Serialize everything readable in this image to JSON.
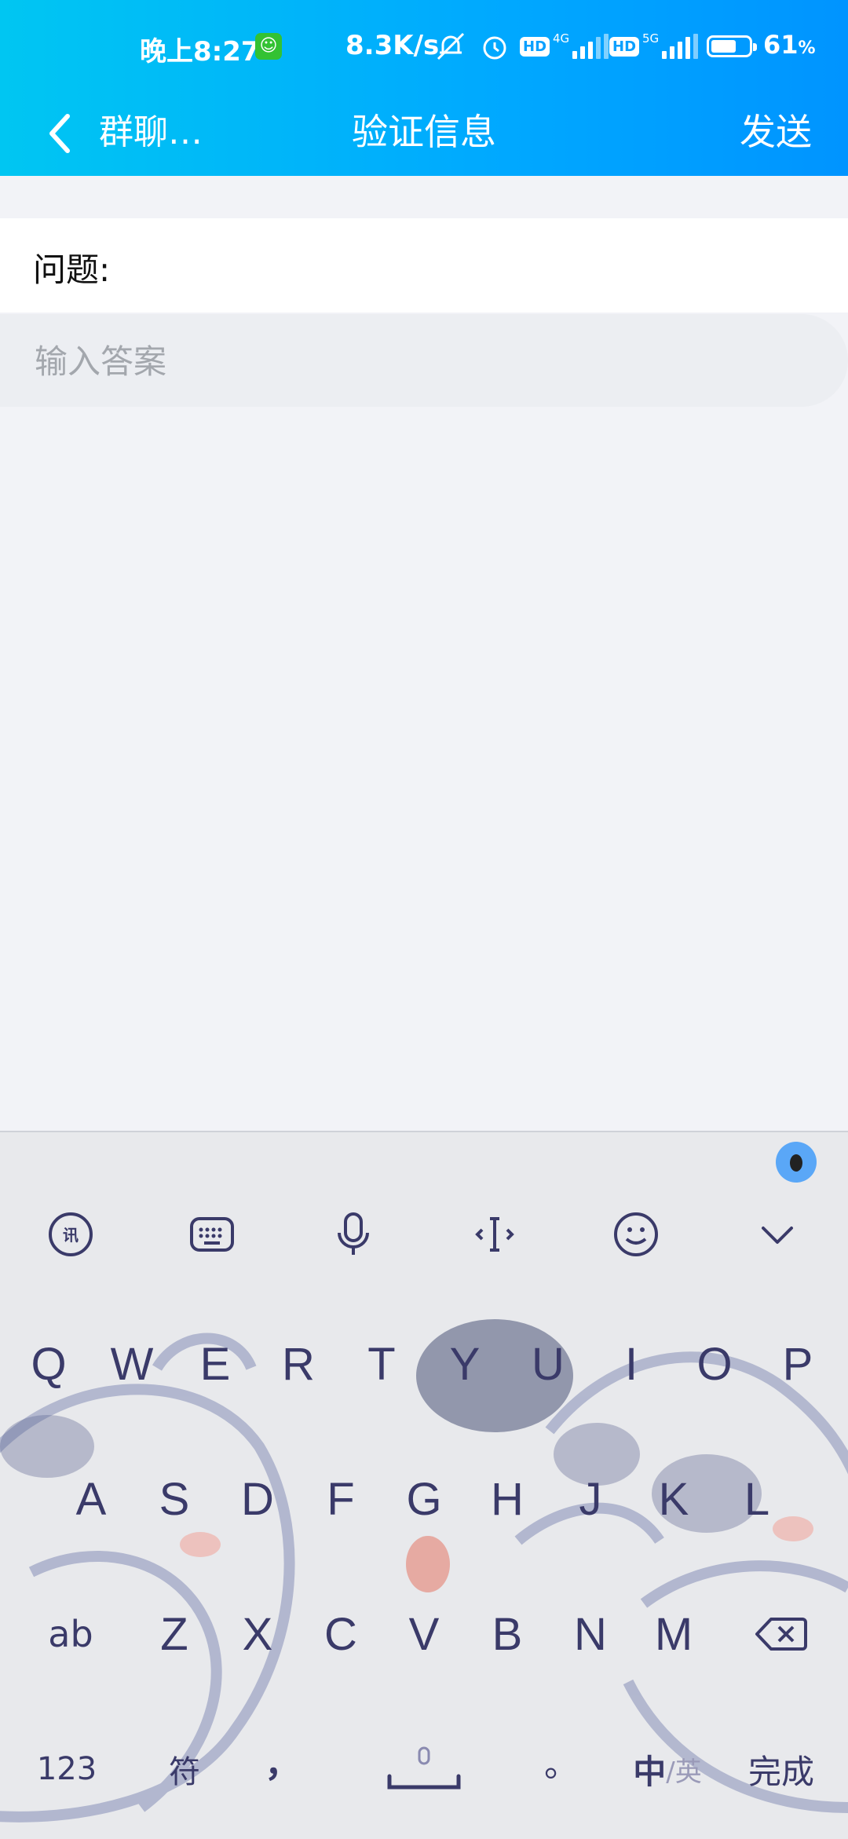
{
  "status_bar": {
    "time": "晚上8:27",
    "net_speed": "8.3K/s",
    "sig1_label": "4G",
    "sig2_label": "5G",
    "hd_label": "HD",
    "battery_pct": "61",
    "battery_unit": "%"
  },
  "nav": {
    "back_icon": "chevron-left-icon",
    "group_name": "群聊…",
    "title": "验证信息",
    "send_label": "发送"
  },
  "form": {
    "question_label": "问题:",
    "answer_placeholder": "输入答案",
    "answer_value": ""
  },
  "keyboard": {
    "toolbar": [
      "logo-icon",
      "keyboard-icon",
      "microphone-icon",
      "cursor-icon",
      "emoji-icon",
      "collapse-icon"
    ],
    "row1": [
      "Q",
      "W",
      "E",
      "R",
      "T",
      "Y",
      "U",
      "I",
      "O",
      "P"
    ],
    "row2": [
      "A",
      "S",
      "D",
      "F",
      "G",
      "H",
      "J",
      "K",
      "L"
    ],
    "row3": [
      "Z",
      "X",
      "C",
      "V",
      "B",
      "N",
      "M"
    ],
    "shift_label": "ab",
    "num_label": "123",
    "symbol_label": "符",
    "comma_label": "，",
    "period_label": "。",
    "lang_main": "中",
    "lang_alt": "/英",
    "done_label": "完成"
  }
}
